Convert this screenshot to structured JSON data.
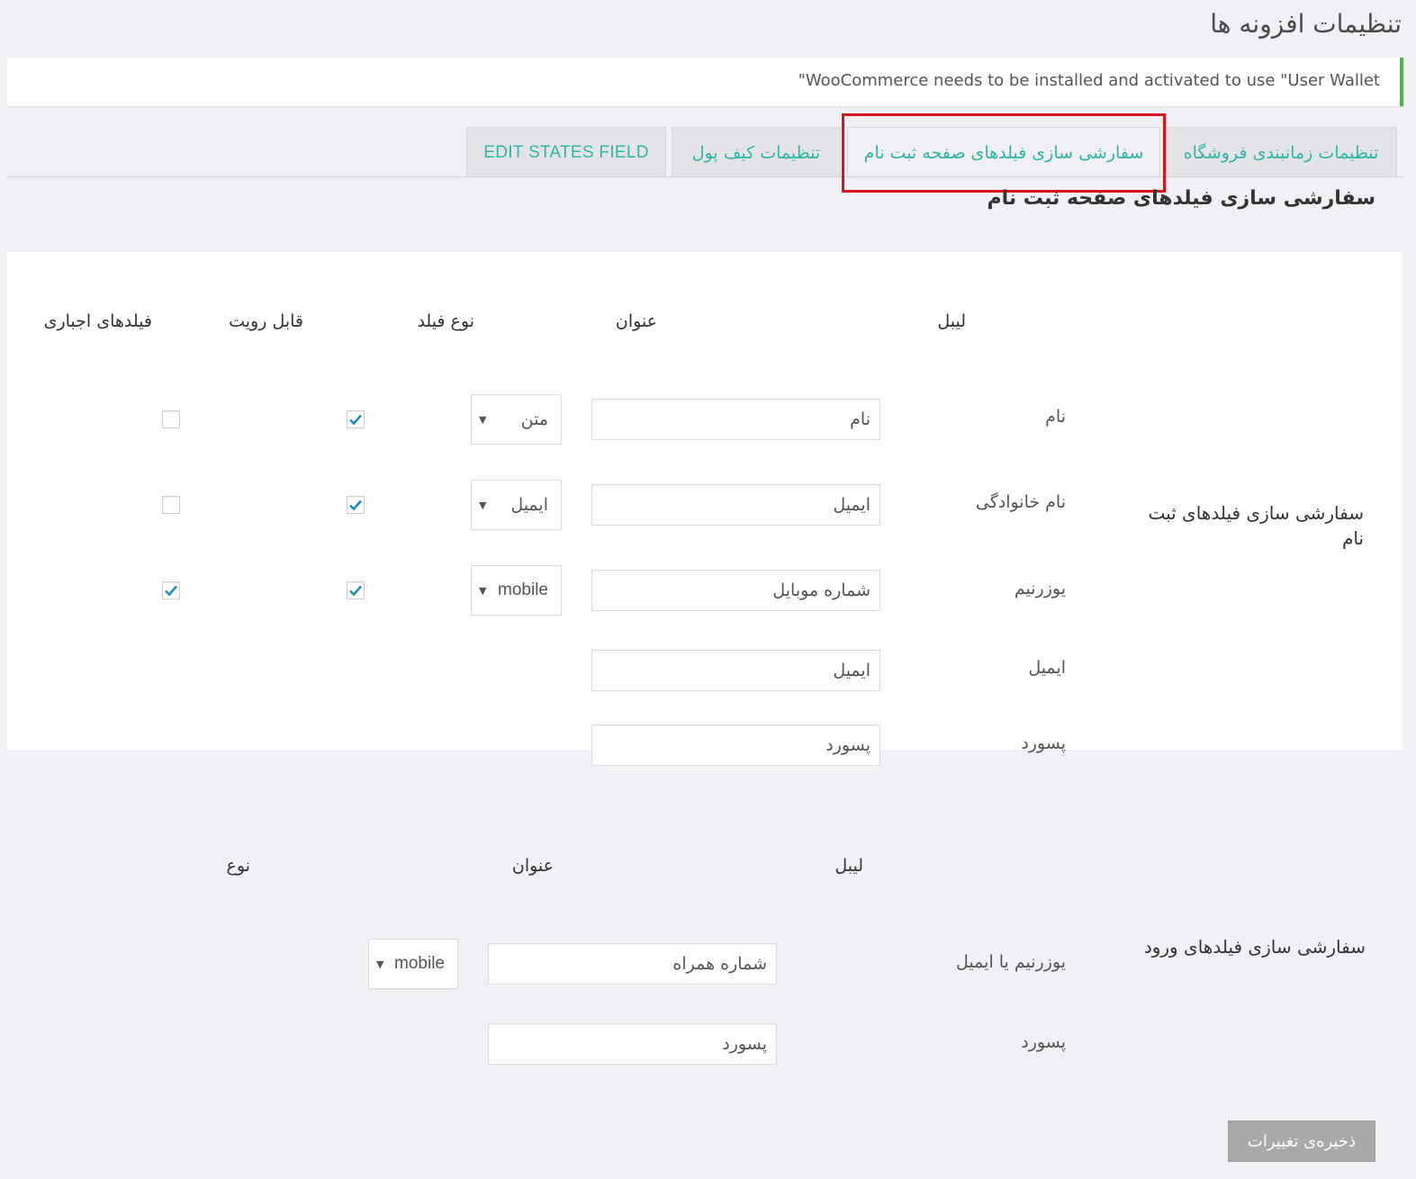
{
  "page": {
    "title": "تنظیمات افزونه ها"
  },
  "notice": {
    "text": "\"WooCommerce needs to be installed and activated to use \"User Wallet",
    "accent_color": "#46b450"
  },
  "tabs": [
    {
      "label": "تنظیمات زمانبندی فروشگاه",
      "active": false
    },
    {
      "label": "سفارشی سازی فیلدهای صفحه ثبت نام",
      "active": true
    },
    {
      "label": "تنظیمات کیف پول",
      "active": false
    },
    {
      "label": "EDIT STATES FIELD",
      "active": false
    }
  ],
  "tab_color": "#2bb6a4",
  "section_title": "سفارشی سازی فیلدهای صفحه ثبت نام",
  "register": {
    "group_title": "سفارشی سازی فیلدهای ثبت نام",
    "headers": {
      "label": "لیبل",
      "title": "عنوان",
      "field_type": "نوع فیلد",
      "visible": "قابل رویت",
      "required": "فیلدهای اجباری"
    },
    "rows": [
      {
        "label": "نام",
        "title": "نام",
        "type": "متن",
        "visible": true,
        "required": false
      },
      {
        "label": "نام خانوادگی",
        "title": "ایمیل",
        "type": "ایمیل",
        "visible": true,
        "required": false
      },
      {
        "label": "یوزرنیم",
        "title": "شماره موبایل",
        "type": "mobile",
        "visible": true,
        "required": true
      },
      {
        "label": "ایمیل",
        "title": "ایمیل"
      },
      {
        "label": "پسورد",
        "title": "پسورد"
      }
    ]
  },
  "login": {
    "group_title": "سفارشی سازی فیلدهای ورود",
    "headers": {
      "label": "لیبل",
      "title": "عنوان",
      "type": "نوع"
    },
    "rows": [
      {
        "label": "یوزرنیم یا ایمیل",
        "title": "شماره همراه",
        "type": "mobile"
      },
      {
        "label": "پسورد",
        "title": "پسورد"
      }
    ]
  },
  "save_button": {
    "label": "ذخیره‌ی تغییرات"
  },
  "icons": {
    "check": "check-icon",
    "dropdown": "chevron-down-icon"
  }
}
